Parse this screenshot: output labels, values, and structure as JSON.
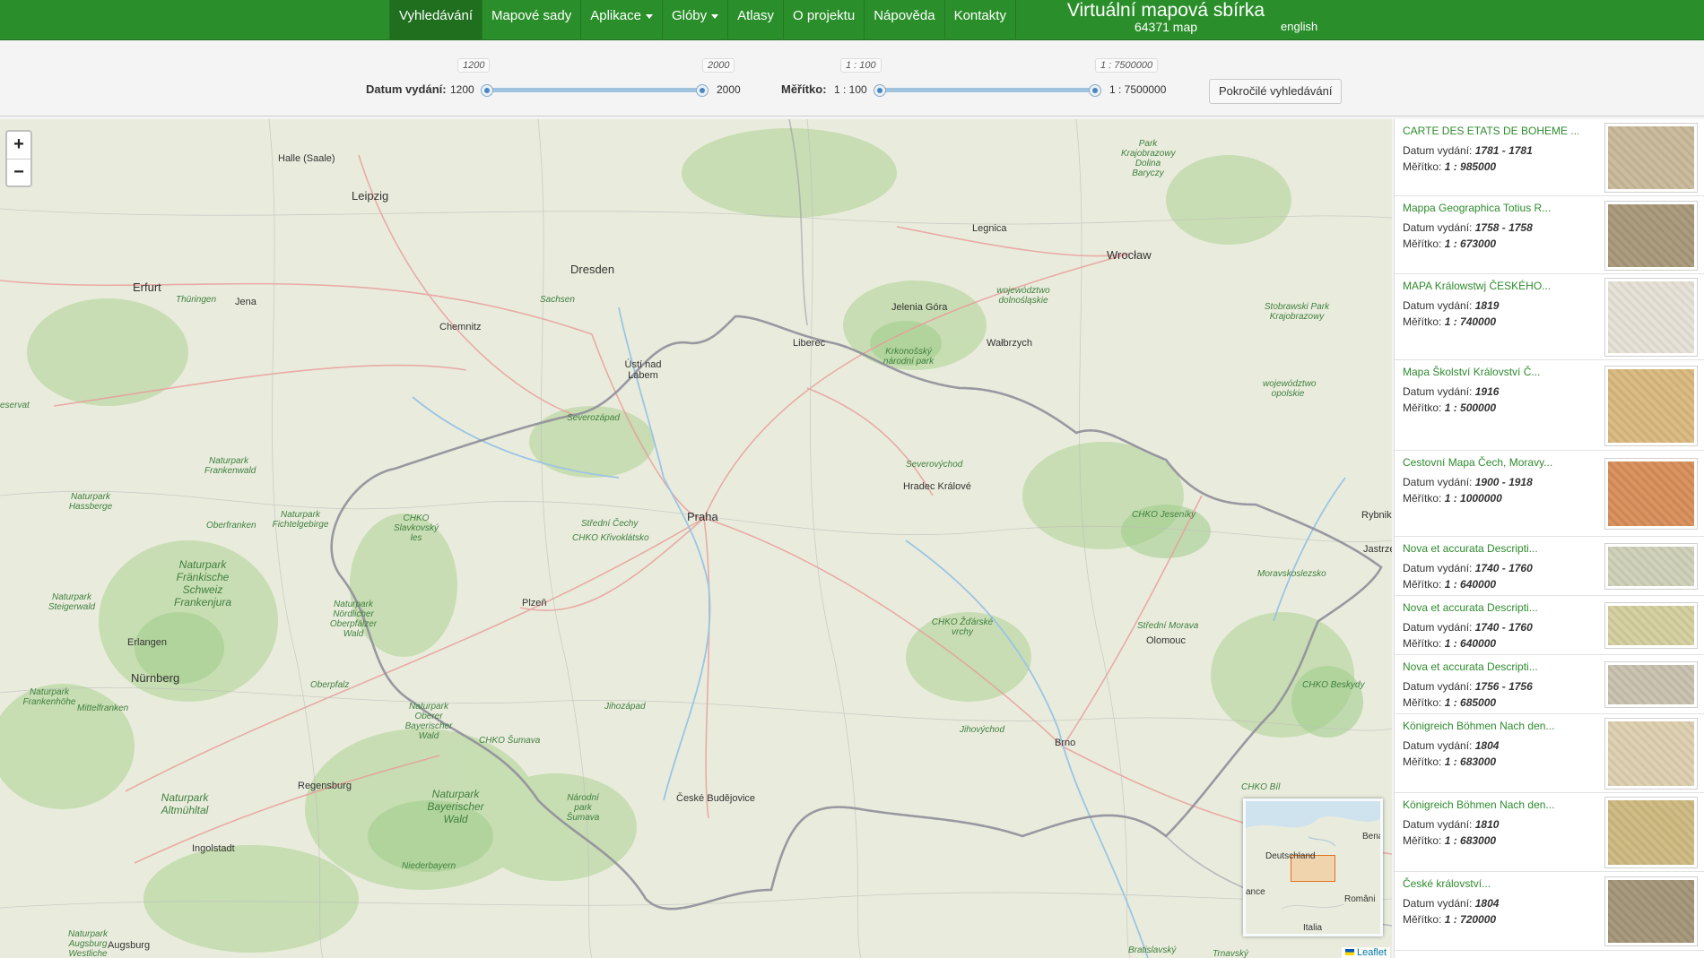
{
  "nav": {
    "items": [
      {
        "label": "Vyhledávání",
        "active": true,
        "dropdown": false
      },
      {
        "label": "Mapové sady",
        "active": false,
        "dropdown": false
      },
      {
        "label": "Aplikace",
        "active": false,
        "dropdown": true
      },
      {
        "label": "Glóby",
        "active": false,
        "dropdown": true
      },
      {
        "label": "Atlasy",
        "active": false,
        "dropdown": false
      },
      {
        "label": "O projektu",
        "active": false,
        "dropdown": false
      },
      {
        "label": "Nápověda",
        "active": false,
        "dropdown": false
      },
      {
        "label": "Kontakty",
        "active": false,
        "dropdown": false
      }
    ],
    "site_title": "Virtuální mapová sbírka",
    "map_count": "64371 map",
    "language": "english"
  },
  "filters": {
    "date": {
      "label": "Datum vydání:",
      "min_label": "1200",
      "max_label": "2000",
      "tip_min": "1200",
      "tip_max": "2000",
      "min": 1200,
      "max": 2000,
      "low": 1200,
      "high": 2000
    },
    "scale": {
      "label": "Měřítko:",
      "min_label": "1 : 100",
      "max_label": "1 : 7500000",
      "tip_min": "1 : 100",
      "tip_max": "1 : 7500000",
      "low_fraction": 0.0,
      "high_fraction": 1.0
    },
    "advanced_button": "Pokročilé vyhledávání"
  },
  "map": {
    "zoom_in": "+",
    "zoom_out": "−",
    "attribution": "Leaflet",
    "labels": [
      {
        "text": "Halle (Saale)",
        "big": false,
        "park": false
      },
      {
        "text": "Leipzig",
        "big": true,
        "park": false
      },
      {
        "text": "Dresden",
        "big": true,
        "park": false
      },
      {
        "text": "Erfurt",
        "big": true,
        "park": false
      },
      {
        "text": "Thüringen",
        "big": false,
        "park": true
      },
      {
        "text": "Jena",
        "big": false,
        "park": false
      },
      {
        "text": "Chemnitz",
        "big": false,
        "park": false
      },
      {
        "text": "Sachsen",
        "big": false,
        "park": true
      },
      {
        "text": "Legnica",
        "big": false,
        "park": false
      },
      {
        "text": "Wrocław",
        "big": true,
        "park": false
      },
      {
        "text": "Jelenia Góra",
        "big": false,
        "park": false
      },
      {
        "text": "Liberec",
        "big": false,
        "park": false
      },
      {
        "text": "Wałbrzych",
        "big": false,
        "park": false
      },
      {
        "text": "Ústí nad Labem",
        "big": false,
        "park": false
      },
      {
        "text": "Severozápad",
        "big": false,
        "park": true
      },
      {
        "text": "Krkonošský národní park",
        "big": false,
        "park": true
      },
      {
        "text": "województwo dolnośląskie",
        "big": false,
        "park": true
      },
      {
        "text": "Park Krajobrazowy Dolina Baryczy",
        "big": false,
        "park": true
      },
      {
        "text": "Stobrawski Park Krajobrazowy",
        "big": false,
        "park": true
      },
      {
        "text": "województwo opolskie",
        "big": false,
        "park": true
      },
      {
        "text": "Severovýchod",
        "big": false,
        "park": true
      },
      {
        "text": "Hradec Králové",
        "big": false,
        "park": false
      },
      {
        "text": "Praha",
        "big": true,
        "park": false
      },
      {
        "text": "Střední Čechy",
        "big": false,
        "park": true
      },
      {
        "text": "CHKO Křivoklátsko",
        "big": false,
        "park": true
      },
      {
        "text": "CHKO Slavkovský les",
        "big": false,
        "park": true
      },
      {
        "text": "Naturpark Frankenwald",
        "big": false,
        "park": true
      },
      {
        "text": "Naturpark Hassberge",
        "big": false,
        "park": true
      },
      {
        "text": "Oberfranken",
        "big": false,
        "park": true
      },
      {
        "text": "Naturpark Fichtelgebirge",
        "big": false,
        "park": true
      },
      {
        "text": "Naturpark Fränkische Schweiz Frankenjura",
        "big": false,
        "park": true
      },
      {
        "text": "Naturpark Steigerwald",
        "big": false,
        "park": true
      },
      {
        "text": "Naturpark Nördlicher Oberpfälzer Wald",
        "big": false,
        "park": true
      },
      {
        "text": "Plzeň",
        "big": false,
        "park": false
      },
      {
        "text": "Erlangen",
        "big": false,
        "park": false
      },
      {
        "text": "Nürnberg",
        "big": true,
        "park": false
      },
      {
        "text": "Naturpark Frankenhöhe",
        "big": false,
        "park": true
      },
      {
        "text": "Mittelfranken",
        "big": false,
        "park": true
      },
      {
        "text": "Oberpfalz",
        "big": false,
        "park": true
      },
      {
        "text": "Naturpark Oberer Bayerischer Wald",
        "big": false,
        "park": true
      },
      {
        "text": "CHKO Šumava",
        "big": false,
        "park": true
      },
      {
        "text": "Jihozápad",
        "big": false,
        "park": true
      },
      {
        "text": "Regensburg",
        "big": false,
        "park": false
      },
      {
        "text": "Naturpark Altmühltal",
        "big": false,
        "park": true
      },
      {
        "text": "Naturpark Bayerischer Wald",
        "big": false,
        "park": true
      },
      {
        "text": "Národní park Šumava",
        "big": false,
        "park": true
      },
      {
        "text": "České Budějovice",
        "big": false,
        "park": false
      },
      {
        "text": "Ingolstadt",
        "big": false,
        "park": false
      },
      {
        "text": "Niederbayern",
        "big": false,
        "park": true
      },
      {
        "text": "Naturpark Augsburg Westliche",
        "big": false,
        "park": true
      },
      {
        "text": "Augsburg",
        "big": false,
        "park": false
      },
      {
        "text": "CHKO Žďárské vrchy",
        "big": false,
        "park": true
      },
      {
        "text": "Jihovýchod",
        "big": false,
        "park": true
      },
      {
        "text": "Brno",
        "big": false,
        "park": false
      },
      {
        "text": "Střední Morava",
        "big": false,
        "park": true
      },
      {
        "text": "Olomouc",
        "big": false,
        "park": false
      },
      {
        "text": "CHKO Jeseníky",
        "big": false,
        "park": true
      },
      {
        "text": "Moravskoslezsko",
        "big": false,
        "park": true
      },
      {
        "text": "Rybnik",
        "big": false,
        "park": false
      },
      {
        "text": "Jastrzę",
        "big": false,
        "park": false
      },
      {
        "text": "CHKO Beskydy",
        "big": false,
        "park": true
      },
      {
        "text": "CHKO Bíl",
        "big": false,
        "park": true
      },
      {
        "text": "Bratislavský",
        "big": false,
        "park": true
      },
      {
        "text": "Trnavský",
        "big": false,
        "park": true
      },
      {
        "text": "eservat",
        "big": false,
        "park": true
      }
    ],
    "minimap": {
      "labels": [
        "Deutschland",
        "Bena",
        "ance",
        "Români",
        "Italia"
      ]
    }
  },
  "results": [
    {
      "title": "CARTE DES ETATS DE BOHEME ...",
      "date_label": "Datum vydání:",
      "date": "1781 - 1781",
      "scale_label": "Měřítko:",
      "scale": "1 : 985000",
      "thumb_color": "#c9b99a"
    },
    {
      "title": "Mappa Geographica Totius R...",
      "date_label": "Datum vydání:",
      "date": "1758 - 1758",
      "scale_label": "Měřítko:",
      "scale": "1 : 673000",
      "thumb_color": "#a8987a"
    },
    {
      "title": "MAPA Králowstwj ČESKÉHO...",
      "date_label": "Datum vydání:",
      "date": "1819",
      "scale_label": "Měřítko:",
      "scale": "1 : 740000",
      "thumb_color": "#e6e1d6"
    },
    {
      "title": "Mapa Školství Království Č...",
      "date_label": "Datum vydání:",
      "date": "1916",
      "scale_label": "Měřítko:",
      "scale": "1 : 500000",
      "thumb_color": "#d9b87e"
    },
    {
      "title": "Cestovní Mapa Čech, Moravy...",
      "date_label": "Datum vydání:",
      "date": "1900 - 1918",
      "scale_label": "Měřítko:",
      "scale": "1 : 1000000",
      "thumb_color": "#d78e5a"
    },
    {
      "title": "Nova et accurata Descripti...",
      "date_label": "Datum vydání:",
      "date": "1740 - 1760",
      "scale_label": "Měřítko:",
      "scale": "1 : 640000",
      "thumb_color": "#cfd0b8"
    },
    {
      "title": "Nova et accurata Descripti...",
      "date_label": "Datum vydání:",
      "date": "1740 - 1760",
      "scale_label": "Měřítko:",
      "scale": "1 : 640000",
      "thumb_color": "#d4cf9e"
    },
    {
      "title": "Nova et accurata Descripti...",
      "date_label": "Datum vydání:",
      "date": "1756 - 1756",
      "scale_label": "Měřítko:",
      "scale": "1 : 685000",
      "thumb_color": "#c9c1ae"
    },
    {
      "title": "Königreich Böhmen Nach den...",
      "date_label": "Datum vydání:",
      "date": "1804",
      "scale_label": "Měřítko:",
      "scale": "1 : 683000",
      "thumb_color": "#ddd0b0"
    },
    {
      "title": "Königreich Böhmen Nach den...",
      "date_label": "Datum vydání:",
      "date": "1810",
      "scale_label": "Měřítko:",
      "scale": "1 : 683000",
      "thumb_color": "#cdb980"
    },
    {
      "title": "České království...",
      "date_label": "Datum vydání:",
      "date": "1804",
      "scale_label": "Měřítko:",
      "scale": "1 : 720000",
      "thumb_color": "#a39577"
    }
  ]
}
